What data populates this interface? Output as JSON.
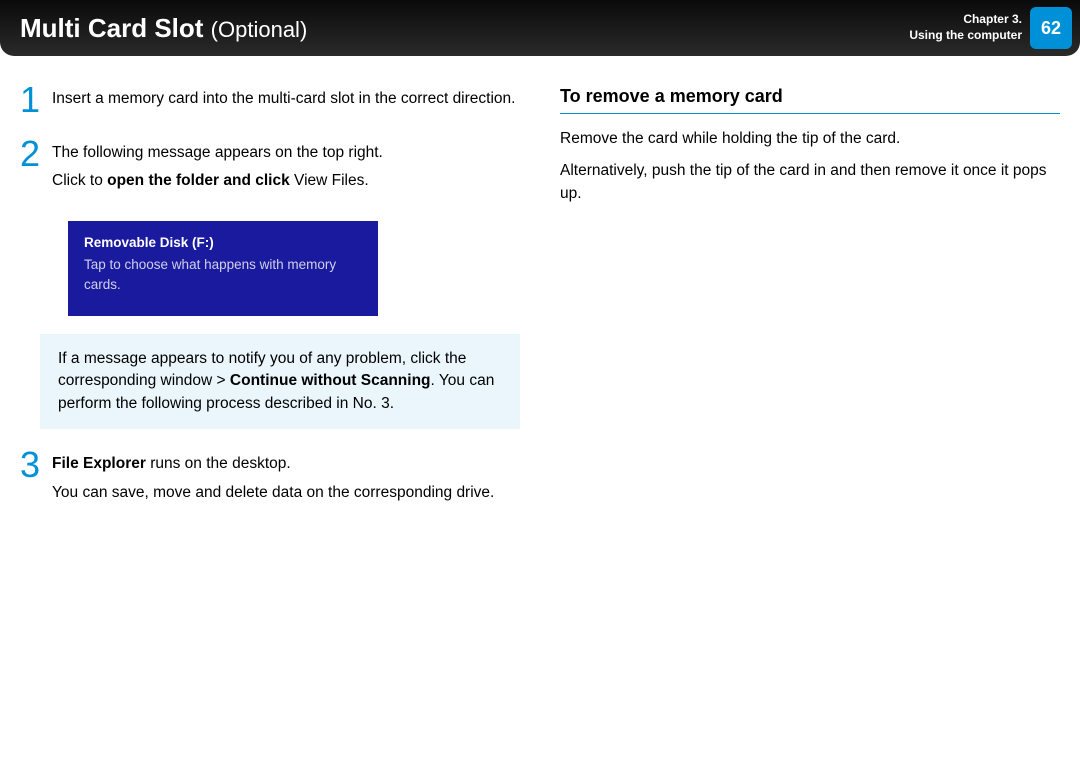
{
  "header": {
    "title_main": "Multi Card Slot",
    "title_optional": "(Optional)",
    "chapter_line1": "Chapter 3.",
    "chapter_line2": "Using the computer",
    "page_number": "62"
  },
  "left": {
    "steps": [
      {
        "num": "1",
        "text": "Insert a memory card into the multi-card slot in the correct direction."
      },
      {
        "num": "2",
        "line1": "The following message appears on the top right.",
        "line2_prefix": "Click to ",
        "line2_bold": "open the folder and click",
        "line2_suffix": " View Files."
      },
      {
        "num": "3",
        "line1_bold": "File Explorer",
        "line1_rest": " runs on the desktop.",
        "line2": "You can save, move and delete data on the corresponding drive."
      }
    ],
    "toast": {
      "title": "Removable Disk (F:)",
      "body": "Tap to choose what happens with memory cards."
    },
    "note": {
      "part1": "If a message appears to notify you of any problem, click the corresponding window > ",
      "bold": "Continue without Scanning",
      "part2": ". You can perform the following process described in No. 3."
    }
  },
  "right": {
    "heading": "To remove a memory card",
    "para1": "Remove the card while holding the tip of the card.",
    "para2": "Alternatively, push the tip of the card in and then remove it once it pops up."
  }
}
